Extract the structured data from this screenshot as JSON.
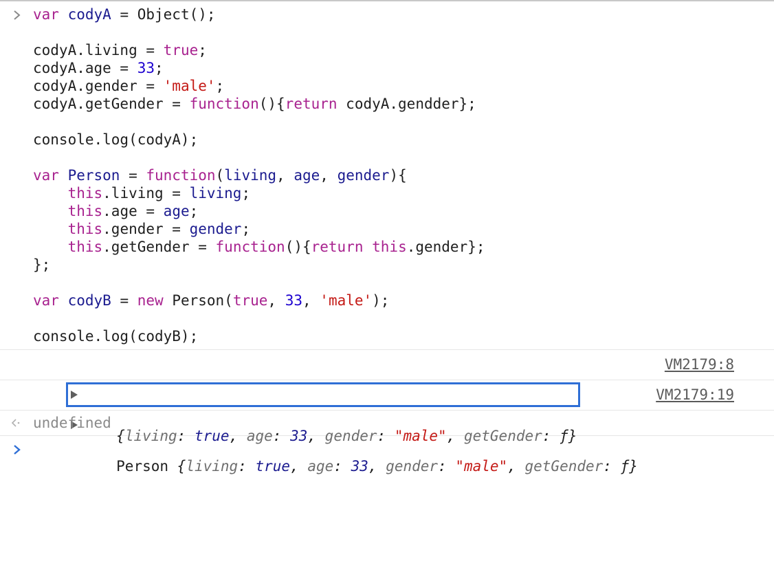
{
  "input": {
    "lines": [
      [
        {
          "t": "var ",
          "c": "kw"
        },
        {
          "t": "codyA",
          "c": "var"
        },
        {
          "t": " = Object();",
          "c": "plain"
        }
      ],
      [],
      [
        {
          "t": "codyA.living = ",
          "c": "plain"
        },
        {
          "t": "true",
          "c": "kw"
        },
        {
          "t": ";",
          "c": "plain"
        }
      ],
      [
        {
          "t": "codyA.age = ",
          "c": "plain"
        },
        {
          "t": "33",
          "c": "num"
        },
        {
          "t": ";",
          "c": "plain"
        }
      ],
      [
        {
          "t": "codyA.gender = ",
          "c": "plain"
        },
        {
          "t": "'male'",
          "c": "str"
        },
        {
          "t": ";",
          "c": "plain"
        }
      ],
      [
        {
          "t": "codyA.getGender = ",
          "c": "plain"
        },
        {
          "t": "function",
          "c": "kw"
        },
        {
          "t": "(){",
          "c": "plain"
        },
        {
          "t": "return",
          "c": "kw"
        },
        {
          "t": " codyA.gendder};",
          "c": "plain"
        }
      ],
      [],
      [
        {
          "t": "console.log(codyA);",
          "c": "plain"
        }
      ],
      [],
      [
        {
          "t": "var ",
          "c": "kw"
        },
        {
          "t": "Person",
          "c": "var"
        },
        {
          "t": " = ",
          "c": "plain"
        },
        {
          "t": "function",
          "c": "kw"
        },
        {
          "t": "(",
          "c": "plain"
        },
        {
          "t": "living",
          "c": "var"
        },
        {
          "t": ", ",
          "c": "plain"
        },
        {
          "t": "age",
          "c": "var"
        },
        {
          "t": ", ",
          "c": "plain"
        },
        {
          "t": "gender",
          "c": "var"
        },
        {
          "t": "){",
          "c": "plain"
        }
      ],
      [
        {
          "t": "    ",
          "c": "plain"
        },
        {
          "t": "this",
          "c": "kw"
        },
        {
          "t": ".living = ",
          "c": "plain"
        },
        {
          "t": "living",
          "c": "var"
        },
        {
          "t": ";",
          "c": "plain"
        }
      ],
      [
        {
          "t": "    ",
          "c": "plain"
        },
        {
          "t": "this",
          "c": "kw"
        },
        {
          "t": ".age = ",
          "c": "plain"
        },
        {
          "t": "age",
          "c": "var"
        },
        {
          "t": ";",
          "c": "plain"
        }
      ],
      [
        {
          "t": "    ",
          "c": "plain"
        },
        {
          "t": "this",
          "c": "kw"
        },
        {
          "t": ".gender = ",
          "c": "plain"
        },
        {
          "t": "gender",
          "c": "var"
        },
        {
          "t": ";",
          "c": "plain"
        }
      ],
      [
        {
          "t": "    ",
          "c": "plain"
        },
        {
          "t": "this",
          "c": "kw"
        },
        {
          "t": ".getGender = ",
          "c": "plain"
        },
        {
          "t": "function",
          "c": "kw"
        },
        {
          "t": "(){",
          "c": "plain"
        },
        {
          "t": "return",
          "c": "kw"
        },
        {
          "t": " ",
          "c": "plain"
        },
        {
          "t": "this",
          "c": "kw"
        },
        {
          "t": ".gender};",
          "c": "plain"
        }
      ],
      [
        {
          "t": "};",
          "c": "plain"
        }
      ],
      [],
      [
        {
          "t": "var ",
          "c": "kw"
        },
        {
          "t": "codyB",
          "c": "var"
        },
        {
          "t": " = ",
          "c": "plain"
        },
        {
          "t": "new ",
          "c": "kw"
        },
        {
          "t": "Person(",
          "c": "plain"
        },
        {
          "t": "true",
          "c": "kw"
        },
        {
          "t": ", ",
          "c": "plain"
        },
        {
          "t": "33",
          "c": "num"
        },
        {
          "t": ", ",
          "c": "plain"
        },
        {
          "t": "'male'",
          "c": "str"
        },
        {
          "t": ");",
          "c": "plain"
        }
      ],
      [],
      [
        {
          "t": "console.log(codyB);",
          "c": "plain"
        }
      ]
    ]
  },
  "logs": [
    {
      "prefix": "",
      "segments": [
        {
          "t": "{",
          "c": "vf"
        },
        {
          "t": "living",
          "c": "key"
        },
        {
          "t": ": ",
          "c": "vf"
        },
        {
          "t": "true",
          "c": "vtrue"
        },
        {
          "t": ", ",
          "c": "vf"
        },
        {
          "t": "age",
          "c": "key"
        },
        {
          "t": ": ",
          "c": "vf"
        },
        {
          "t": "33",
          "c": "vnum"
        },
        {
          "t": ", ",
          "c": "vf"
        },
        {
          "t": "gender",
          "c": "key"
        },
        {
          "t": ": ",
          "c": "vf"
        },
        {
          "t": "\"male\"",
          "c": "vstr"
        },
        {
          "t": ", ",
          "c": "vf"
        },
        {
          "t": "getGender",
          "c": "key"
        },
        {
          "t": ": ",
          "c": "vf"
        },
        {
          "t": "ƒ",
          "c": "vf"
        },
        {
          "t": "}",
          "c": "vf"
        }
      ],
      "source": "VM2179:8",
      "focused": true
    },
    {
      "prefix": "Person ",
      "segments": [
        {
          "t": "{",
          "c": "vf"
        },
        {
          "t": "living",
          "c": "key"
        },
        {
          "t": ": ",
          "c": "vf"
        },
        {
          "t": "true",
          "c": "vtrue"
        },
        {
          "t": ", ",
          "c": "vf"
        },
        {
          "t": "age",
          "c": "key"
        },
        {
          "t": ": ",
          "c": "vf"
        },
        {
          "t": "33",
          "c": "vnum"
        },
        {
          "t": ", ",
          "c": "vf"
        },
        {
          "t": "gender",
          "c": "key"
        },
        {
          "t": ": ",
          "c": "vf"
        },
        {
          "t": "\"male\"",
          "c": "vstr"
        },
        {
          "t": ", ",
          "c": "vf"
        },
        {
          "t": "getGender",
          "c": "key"
        },
        {
          "t": ": ",
          "c": "vf"
        },
        {
          "t": "ƒ",
          "c": "vf"
        },
        {
          "t": "}",
          "c": "vf"
        }
      ],
      "source": "VM2179:19",
      "focused": false
    }
  ],
  "result": {
    "value": "undefined"
  },
  "icons": {
    "input_prompt": "chevron-right-icon",
    "result_arrow": "return-arrow-icon",
    "active_prompt": "chevron-right-icon",
    "expand": "expand-triangle-icon"
  },
  "colors": {
    "focus_outline": "#2f6fd6",
    "active_prompt": "#2f6fd6"
  }
}
